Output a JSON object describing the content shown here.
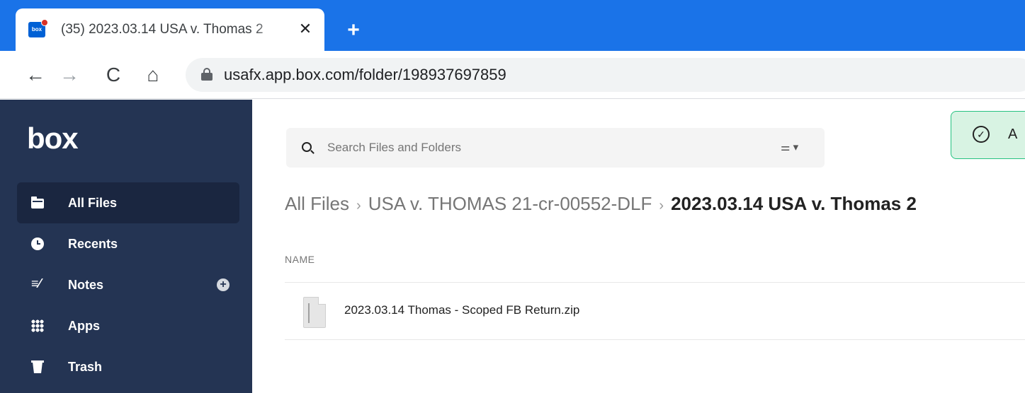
{
  "browser": {
    "tab_title": "(35) 2023.03.14 USA v. Thomas 2",
    "tab_close": "✕",
    "new_tab": "+",
    "favicon_text": "box",
    "nav_back": "←",
    "nav_forward": "→",
    "nav_reload": "C",
    "nav_home": "⌂",
    "url": "usafx.app.box.com/folder/198937697859"
  },
  "sidebar": {
    "logo": "box",
    "items": [
      {
        "label": "All Files",
        "icon": "folder-icon",
        "active": true
      },
      {
        "label": "Recents",
        "icon": "clock-icon"
      },
      {
        "label": "Notes",
        "icon": "notes-icon",
        "action": "add-icon"
      },
      {
        "label": "Apps",
        "icon": "apps-grid-icon"
      },
      {
        "label": "Trash",
        "icon": "trash-icon"
      }
    ],
    "notes_glyph": "≡⁄",
    "add_glyph": "+"
  },
  "search": {
    "placeholder": "Search Files and Folders",
    "filter_glyph": "⚌ ▾"
  },
  "toast": {
    "text": "A",
    "check_glyph": "✓"
  },
  "breadcrumb": {
    "items": [
      "All Files",
      "USA v. THOMAS 21-cr-00552-DLF"
    ],
    "current": "2023.03.14 USA v. Thomas 2",
    "separator": "›"
  },
  "list": {
    "column_header": "NAME",
    "files": [
      {
        "name": "2023.03.14 Thomas - Scoped FB Return.zip"
      }
    ]
  },
  "colors": {
    "chrome_blue": "#1a73e8",
    "sidebar_bg": "#243453",
    "toast_bg": "#d8f3e3",
    "toast_border": "#26c281"
  }
}
